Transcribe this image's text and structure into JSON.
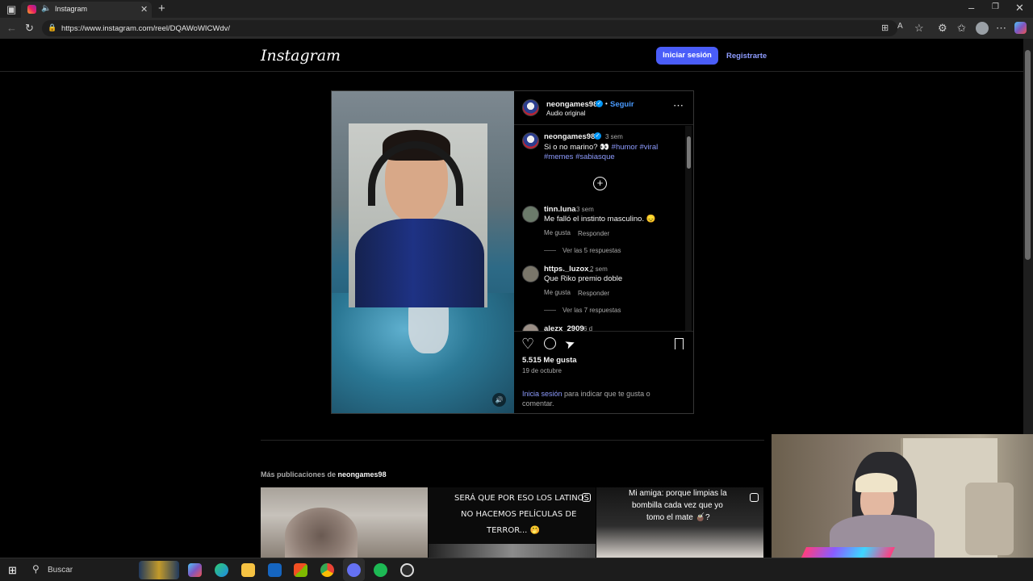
{
  "browser": {
    "tab_title": "Instagram",
    "url": "https://www.instagram.com/reel/DQAWoWICWdv/"
  },
  "nav": {
    "logo": "Instagram",
    "login_label": "Iniciar sesión",
    "signup_label": "Registrarte"
  },
  "post": {
    "username": "neongames98",
    "follow_label": "Seguir",
    "audio": "Audio original",
    "caption": {
      "username": "neongames98",
      "time": "3 sem",
      "text": "Si o no marino? 👀",
      "tags_line1": "#humor #viral",
      "tags_line2": "#memes #sabiasque"
    },
    "comments": [
      {
        "username": "tinn.luna",
        "time": "3 sem",
        "text": "Me falló el instinto masculino. 😞",
        "like": "Me gusta",
        "reply": "Responder",
        "replies": "Ver las 5 respuestas"
      },
      {
        "username": "https._luzox_",
        "time": "2 sem",
        "text": "Que Riko premio doble",
        "like": "Me gusta",
        "reply": "Responder",
        "replies": "Ver las 7 respuestas"
      },
      {
        "username": "alezx_2909",
        "time": "6 d"
      }
    ],
    "likes": "5.515 Me gusta",
    "date": "19 de octubre",
    "login_prompt_link": "Inicia sesión",
    "login_prompt_rest_1": "para indicar que te gusta o",
    "login_prompt_rest_2": "comentar."
  },
  "more": {
    "label": "Más publicaciones de",
    "user": "neongames98",
    "thumb2_text_1": "SERÁ QUE POR ESO LOS LATINOS",
    "thumb2_text_2": "NO HACEMOS  PELÍCULAS DE",
    "thumb2_text_3": "TERROR... 🤭",
    "thumb3_text_1": "Mi amiga: porque limpias la",
    "thumb3_text_2": "bombilla cada vez que yo",
    "thumb3_text_3": "tomo el mate 🧉?"
  },
  "taskbar": {
    "search_label": "Buscar"
  },
  "colors": {
    "accent_button": "#4a5df9",
    "link": "#8e9cff",
    "verified": "#0095f6"
  }
}
